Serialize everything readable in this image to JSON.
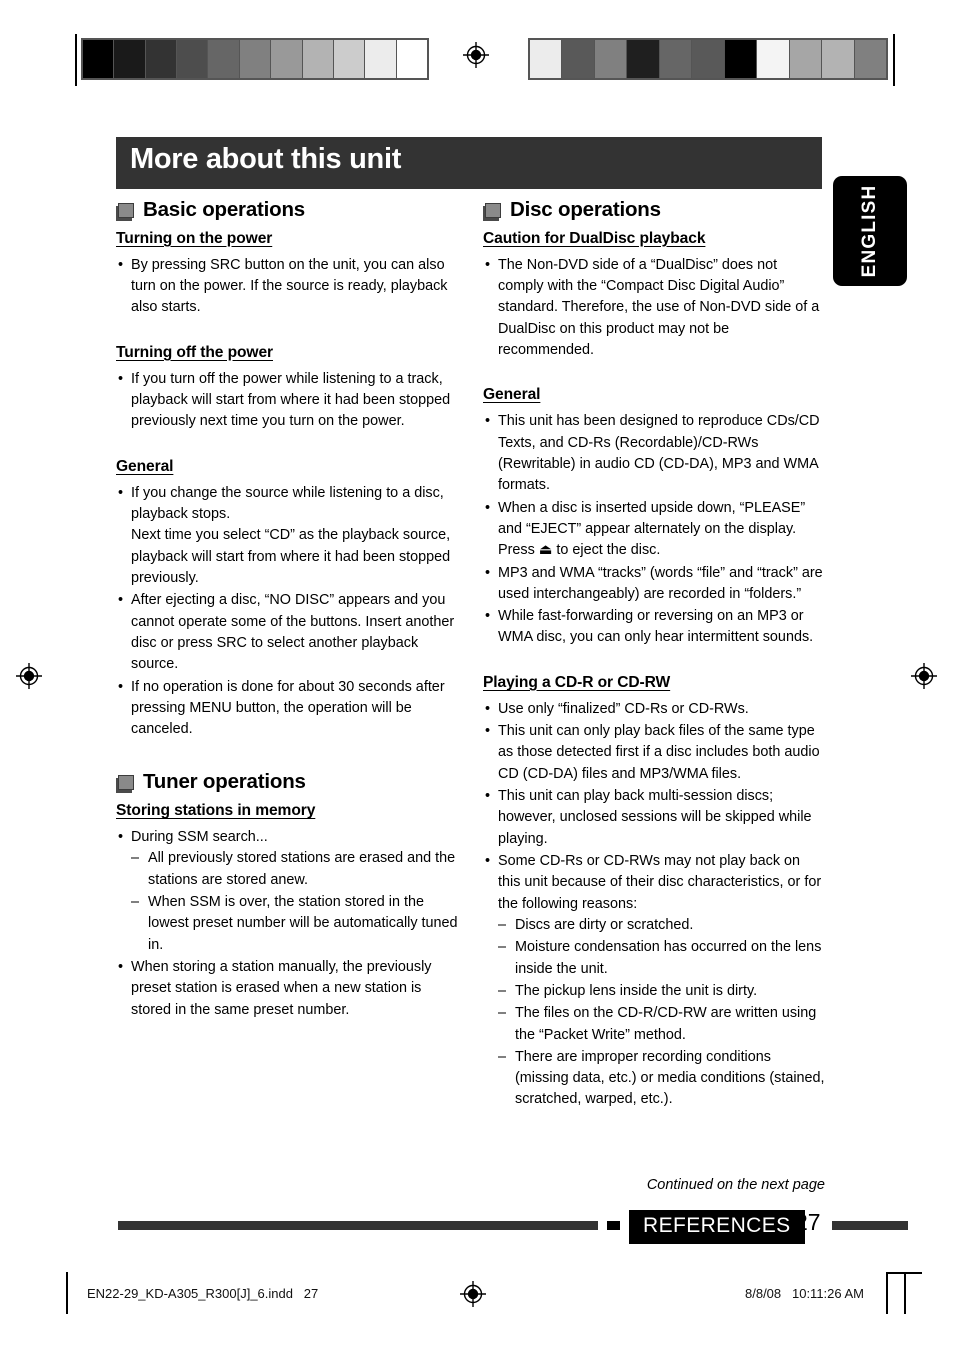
{
  "page": {
    "title": "More about this unit",
    "side_tab": "ENGLISH",
    "continued_note": "Continued on the next page",
    "footer_badge": "REFERENCES",
    "page_number": "27",
    "file_name": "EN22-29_KD-A305_R300[J]_6.indd",
    "file_page": "27",
    "print_date": "8/8/08",
    "print_time": "10:11:26 AM",
    "colors": {
      "title_bar": "#333333",
      "tab": "#000000",
      "badge": "#000000",
      "rule": "#333333"
    }
  },
  "calibration": {
    "left_swatches": [
      "#000000",
      "#1a1a1a",
      "#333333",
      "#4d4d4d",
      "#666666",
      "#808080",
      "#999999",
      "#b3b3b3",
      "#cccccc",
      "#ececec",
      "#ffffff"
    ],
    "right_swatches": [
      "#ececec",
      "#595959",
      "#808080",
      "#1f1f1f",
      "#666666",
      "#595959",
      "#000000",
      "#f4f4f4",
      "#a6a6a6",
      "#b3b3b3",
      "#808080"
    ]
  },
  "left_column": {
    "sections": [
      {
        "icon": "square-marker-icon",
        "title": "Basic operations",
        "groups": [
          {
            "heading": "Turning on the power",
            "items": [
              {
                "mark": "•",
                "text": "By pressing SRC button on the unit, you can also turn on the power. If the source is ready, playback also starts."
              }
            ]
          },
          {
            "heading": "Turning off the power",
            "items": [
              {
                "mark": "•",
                "text": "If you turn off the power while listening to a track, playback will start from where it had been stopped previously next time you turn on the power."
              }
            ]
          },
          {
            "heading": "General",
            "items": [
              {
                "mark": "•",
                "text": "If you change the source while listening to a disc, playback stops.",
                "continuation": "Next time you select “CD” as the playback source, playback will start from where it had been stopped previously."
              },
              {
                "mark": "•",
                "text": "After ejecting a disc, “NO DISC” appears and you cannot operate some of the buttons. Insert another disc or press SRC to select another playback source."
              },
              {
                "mark": "•",
                "text": "If no operation is done for about 30 seconds after pressing MENU button, the operation will be canceled."
              }
            ]
          }
        ]
      },
      {
        "icon": "square-marker-icon",
        "title": "Tuner operations",
        "groups": [
          {
            "heading": "Storing stations in memory",
            "items": [
              {
                "mark": "•",
                "text": "During SSM search...",
                "sub_items": [
                  {
                    "mark": "–",
                    "text": "All previously stored stations are erased and the stations are stored anew."
                  },
                  {
                    "mark": "–",
                    "text": "When SSM is over, the station stored in the lowest preset number will be automatically tuned in."
                  }
                ]
              },
              {
                "mark": "•",
                "text": "When storing a station manually, the previously preset station is erased when a new station is stored in the same preset number."
              }
            ]
          }
        ]
      }
    ]
  },
  "right_column": {
    "sections": [
      {
        "icon": "square-marker-icon",
        "title": "Disc operations",
        "groups": [
          {
            "heading": "Caution for DualDisc playback",
            "items": [
              {
                "mark": "•",
                "text": "The Non-DVD side of a “DualDisc” does not comply with the “Compact Disc Digital Audio” standard. Therefore, the use of Non-DVD side of a DualDisc on this product may not be recommended."
              }
            ]
          },
          {
            "heading": "General",
            "items": [
              {
                "mark": "•",
                "text": "This unit has been designed to reproduce CDs/CD Texts, and CD-Rs (Recordable)/CD-RWs (Rewritable) in audio CD (CD-DA), MP3 and WMA formats."
              },
              {
                "mark": "•",
                "text": "When a disc is inserted upside down, “PLEASE” and “EJECT” appear alternately on the display. Press ⏏ to eject the disc."
              },
              {
                "mark": "•",
                "text": "MP3 and WMA “tracks” (words “file” and “track” are used interchangeably) are recorded in “folders.”"
              },
              {
                "mark": "•",
                "text": "While fast-forwarding or reversing on an MP3 or WMA disc, you can only hear intermittent sounds."
              }
            ]
          },
          {
            "heading": "Playing a CD-R or CD-RW",
            "items": [
              {
                "mark": "•",
                "text": "Use only “finalized” CD-Rs or CD-RWs."
              },
              {
                "mark": "•",
                "text": "This unit can only play back files of the same type as those detected first if a disc includes both audio CD (CD-DA) files and MP3/WMA files."
              },
              {
                "mark": "•",
                "text": "This unit can play back multi-session discs; however, unclosed sessions will be skipped while playing."
              },
              {
                "mark": "•",
                "text": "Some CD-Rs or CD-RWs may not play back on this unit because of their disc characteristics, or for the following reasons:",
                "sub_items": [
                  {
                    "mark": "–",
                    "text": "Discs are dirty or scratched."
                  },
                  {
                    "mark": "–",
                    "text": "Moisture condensation has occurred on the lens inside the unit."
                  },
                  {
                    "mark": "–",
                    "text": "The pickup lens inside the unit is dirty."
                  },
                  {
                    "mark": "–",
                    "text": "The files on the CD-R/CD-RW are written using the “Packet Write” method."
                  },
                  {
                    "mark": "–",
                    "text": "There are improper recording conditions (missing data, etc.) or media conditions (stained, scratched, warped, etc.)."
                  }
                ]
              }
            ]
          }
        ]
      }
    ]
  }
}
